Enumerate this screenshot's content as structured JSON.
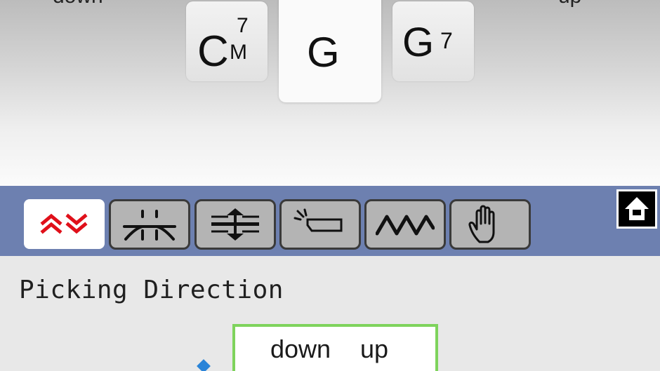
{
  "header": {
    "left_label": "down",
    "right_label": "up"
  },
  "chords": {
    "prev": {
      "root": "C",
      "superscript": "7",
      "subscript": "M"
    },
    "current": {
      "root": "G"
    },
    "next": {
      "root": "G",
      "superscript": "7"
    }
  },
  "toolbar": {
    "tools": [
      {
        "icon": "picking-direction-icon",
        "active": true
      },
      {
        "icon": "bridge-icon",
        "active": false
      },
      {
        "icon": "vertical-expand-icon",
        "active": false
      },
      {
        "icon": "slide-icon",
        "active": false
      },
      {
        "icon": "wave-vibrato-icon",
        "active": false
      },
      {
        "icon": "hand-icon",
        "active": false
      }
    ],
    "home_icon": "home-icon"
  },
  "section": {
    "title": "Picking Direction"
  },
  "direction": {
    "options": [
      "down",
      "up"
    ]
  },
  "colors": {
    "toolbar_bg": "#6d80b0",
    "active_icon": "#e0101a",
    "selection_border": "#7ed35c",
    "pointer": "#2a84d8"
  }
}
